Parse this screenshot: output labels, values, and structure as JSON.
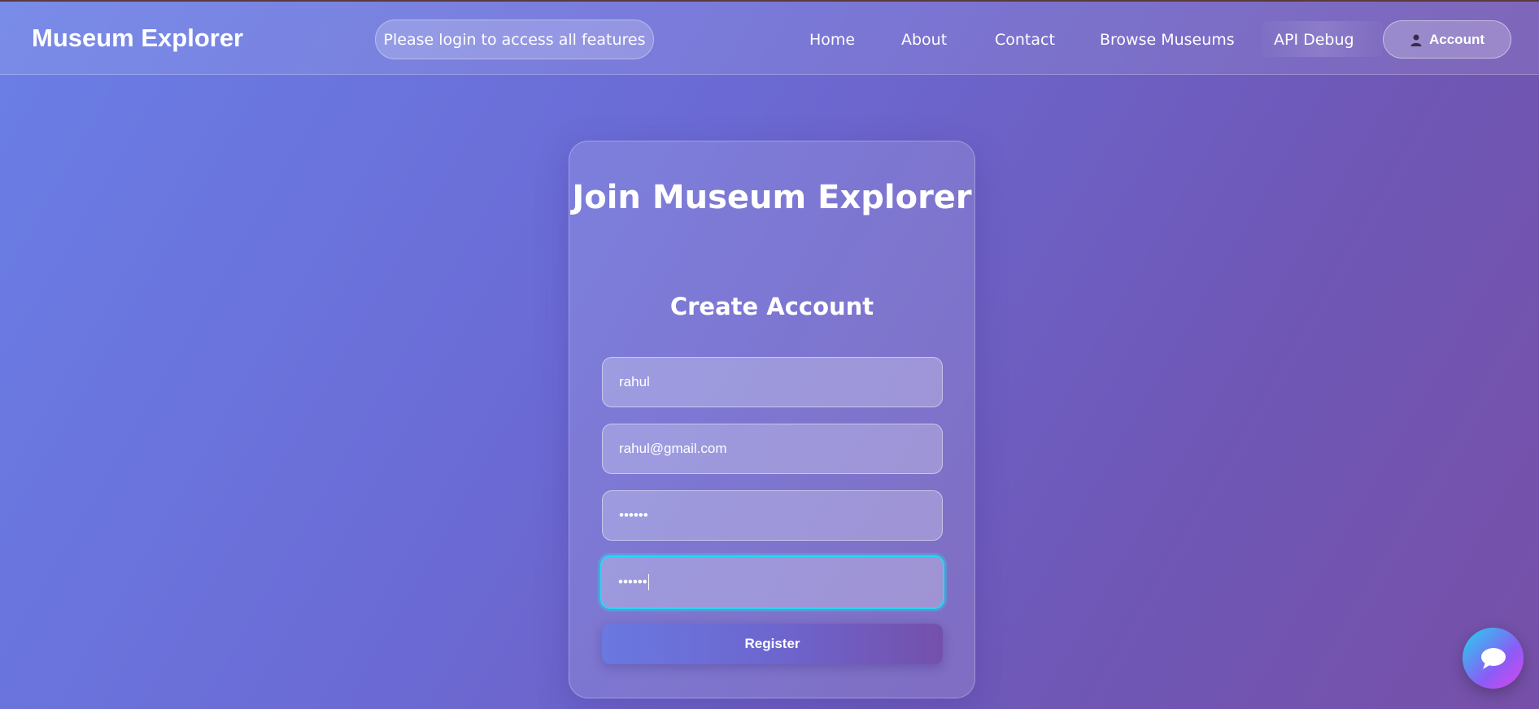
{
  "header": {
    "brand": "Museum Explorer",
    "notice": "Please login to access all features",
    "nav": {
      "home": "Home",
      "about": "About",
      "contact": "Contact",
      "browse": "Browse Museums",
      "api_debug": "API Debug"
    },
    "account_label": "Account",
    "account_icon": "user-icon"
  },
  "form": {
    "title": "Join Museum Explorer",
    "subtitle": "Create Account",
    "username_value": "rahul",
    "email_value": "rahul@gmail.com",
    "password_value": "••••••",
    "confirm_password_value": "••••••",
    "register_label": "Register"
  },
  "chat": {
    "icon": "chat-bubble-icon"
  },
  "colors": {
    "focus_ring": "#27d8f2",
    "bg_start": "#6a7fe6",
    "bg_end": "#7650a8"
  }
}
